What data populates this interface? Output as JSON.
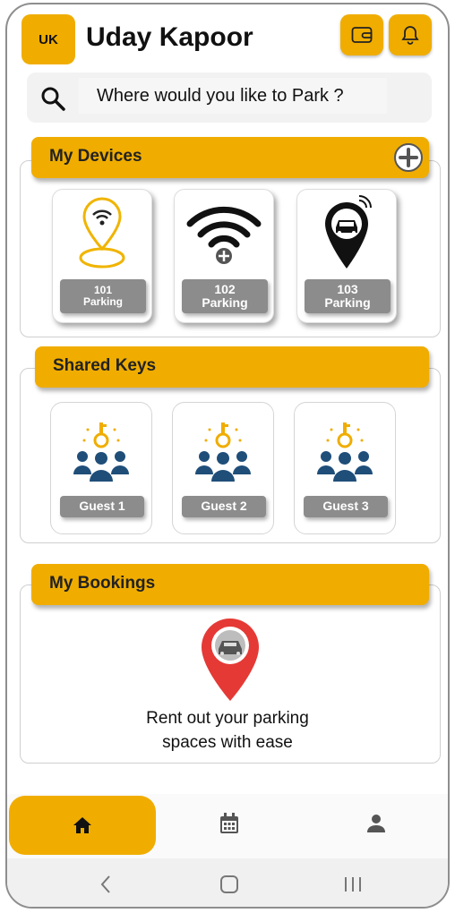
{
  "header": {
    "avatar_initials": "UK",
    "user_name": "Uday Kapoor",
    "wallet_icon": "wallet-icon",
    "bell_icon": "bell-icon"
  },
  "search": {
    "placeholder": "Where would you like to Park ?"
  },
  "devices": {
    "title": "My Devices",
    "items": [
      {
        "number": "101",
        "label": "Parking",
        "icon": "location-pin-wifi-icon"
      },
      {
        "number": "102",
        "label": "Parking",
        "icon": "wifi-add-icon"
      },
      {
        "number": "103",
        "label": "Parking",
        "icon": "car-pin-icon"
      }
    ]
  },
  "shared_keys": {
    "title": "Shared Keys",
    "items": [
      {
        "label": "Guest 1",
        "icon": "key-group-icon"
      },
      {
        "label": "Guest 2",
        "icon": "key-group-icon"
      },
      {
        "label": "Guest 3",
        "icon": "key-group-icon"
      }
    ]
  },
  "bookings": {
    "title": "My Bookings",
    "line1": "Rent out your parking",
    "line2": "spaces with ease"
  },
  "nav": {
    "active": "home",
    "items": [
      "home-icon",
      "calendar-icon",
      "profile-icon"
    ]
  },
  "colors": {
    "accent": "#f0ad00",
    "label_bg": "#8c8c8c",
    "key_blue": "#1f4e79",
    "pin_red": "#e53935"
  }
}
